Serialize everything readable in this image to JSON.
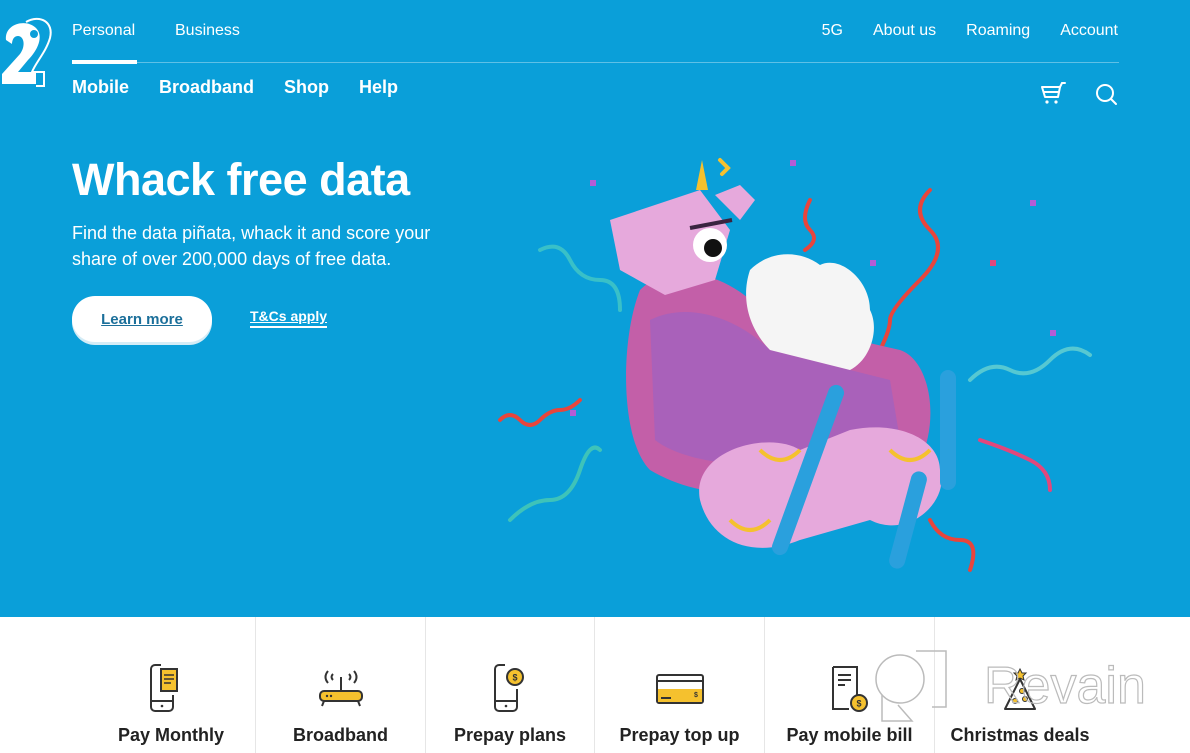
{
  "brand": {
    "logo_label": "2degrees",
    "accent_color": "#0a9fd9",
    "highlight_color": "#f5c12e"
  },
  "top_nav": {
    "segments": [
      {
        "label": "Personal",
        "active": true
      },
      {
        "label": "Business",
        "active": false
      }
    ],
    "utility_links": [
      "5G",
      "About us",
      "Roaming",
      "Account"
    ]
  },
  "main_nav": {
    "items": [
      "Mobile",
      "Broadband",
      "Shop",
      "Help"
    ],
    "icons": [
      "cart-icon",
      "search-icon"
    ]
  },
  "hero": {
    "title": "Whack free data",
    "subtitle": "Find the data piñata, whack it and score your share of over 200,000 days of free data.",
    "cta_label": "Learn more",
    "terms_label": "T&Cs apply",
    "image_description": "Pink unicorn llama piñata with white wings and confetti streamers"
  },
  "quick_links": [
    {
      "label": "Pay Monthly",
      "icon": "phone-document-icon"
    },
    {
      "label": "Broadband",
      "icon": "router-icon"
    },
    {
      "label": "Prepay plans",
      "icon": "phone-coin-icon"
    },
    {
      "label": "Prepay top up",
      "icon": "card-icon"
    },
    {
      "label": "Pay mobile bill",
      "icon": "bill-coin-icon"
    },
    {
      "label": "Christmas deals",
      "icon": "christmas-tree-icon"
    }
  ],
  "watermark": {
    "text": "Revain"
  }
}
